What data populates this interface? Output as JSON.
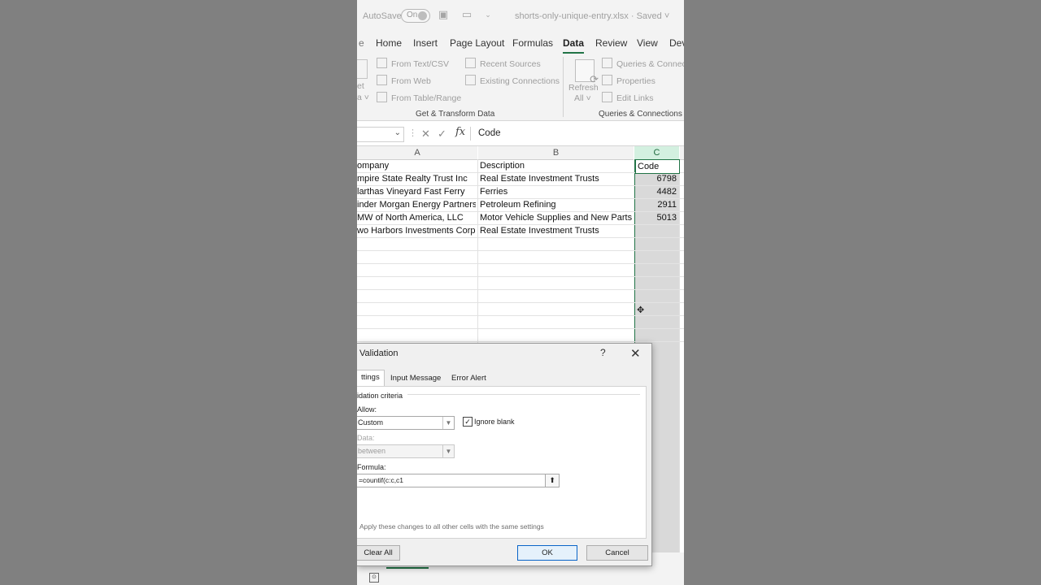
{
  "titlebar": {
    "autosave_label": "AutoSave",
    "autosave_state": "On",
    "filename": "shorts-only-unique-entry.xlsx  ·  Saved  ˅"
  },
  "ribbon_tabs": [
    "Home",
    "Insert",
    "Page Layout",
    "Formulas",
    "Data",
    "Review",
    "View",
    "Dev"
  ],
  "active_tab": "Data",
  "ribbon": {
    "get_transform": {
      "partial_left_top": "et",
      "partial_left_bottom": "a ˅",
      "from_text_csv": "From Text/CSV",
      "from_web": "From Web",
      "from_table_range": "From Table/Range",
      "recent_sources": "Recent Sources",
      "existing_connections": "Existing Connections",
      "group_label": "Get & Transform Data"
    },
    "queries": {
      "refresh_label": "Refresh",
      "refresh_all": "All ˅",
      "queries_connections": "Queries & Connecti",
      "properties": "Properties",
      "edit_links": "Edit Links",
      "group_label": "Queries & Connections"
    }
  },
  "formula_bar": {
    "cancel_glyph": "✕",
    "enter_glyph": "✓",
    "fx_glyph": "fx",
    "value": "Code"
  },
  "sheet": {
    "columns": [
      "A",
      "B",
      "C"
    ],
    "rows": [
      [
        "ompany",
        "Description",
        "Code"
      ],
      [
        "mpire State Realty Trust Inc",
        "Real Estate Investment Trusts",
        "6798"
      ],
      [
        "larthas Vineyard Fast Ferry",
        "Ferries",
        "4482"
      ],
      [
        "inder Morgan Energy Partners",
        "Petroleum Refining",
        "2911"
      ],
      [
        "MW of North America, LLC",
        "Motor Vehicle Supplies and New Parts",
        "5013"
      ],
      [
        "wo Harbors Investments Corp",
        "Real Estate Investment Trusts",
        ""
      ]
    ]
  },
  "dialog": {
    "title": "Validation",
    "help": "?",
    "close": "✕",
    "tabs": [
      "ttings",
      "Input Message",
      "Error Alert"
    ],
    "criteria_label": "idation criteria",
    "allow_label": "Allow:",
    "allow_value": "Custom",
    "ignore_blank_label": "Ignore blank",
    "ignore_blank_checked": true,
    "data_label": "Data:",
    "data_value": "between",
    "formula_label": "Formula:",
    "formula_value": "=countif(c:c,c1",
    "apply_text": "Apply these changes to all other cells with the same settings",
    "clear_all": "Clear All",
    "ok": "OK",
    "cancel": "Cancel"
  },
  "colors": {
    "accent": "#217346",
    "ok_border": "#0a64c8",
    "sel_column": "#d9d9d9"
  }
}
